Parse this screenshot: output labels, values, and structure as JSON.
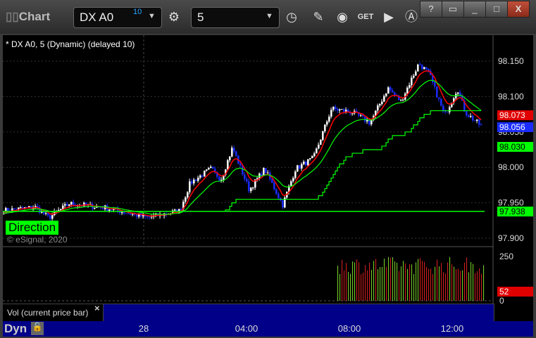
{
  "window": {
    "title": "Chart",
    "help": "?",
    "min": "_",
    "max": "□",
    "close": "X"
  },
  "toolbar": {
    "symbol": "DX A0",
    "symbol_badge": "10",
    "interval": "5"
  },
  "chart": {
    "legend": "* DX A0, 5 (Dynamic) (delayed 10)",
    "direction_label": "Direction",
    "copyright": "© eSignal, 2020",
    "price_ticks": [
      "98.150",
      "98.100",
      "98.050",
      "98.000",
      "97.950",
      "97.900"
    ],
    "price_labels": {
      "red_ma": "98.073",
      "last": "98.056",
      "green_ma": "98.030",
      "support": "97.938"
    },
    "vol_ticks": [
      "250",
      "0"
    ],
    "vol_label": "52",
    "vol_pane_title": "Vol (current price bar)",
    "vol_close": "×"
  },
  "datebar": {
    "mode": "Dyn",
    "ticks": [
      "28",
      "04:00",
      "08:00",
      "12:00"
    ]
  },
  "colors": {
    "up": "#ffffff",
    "down": "#1a2cff",
    "ma_fast": "#ff0000",
    "ma_slow": "#00ff00",
    "bg": "#000000",
    "pane": "#000088"
  },
  "chart_data": {
    "type": "candlestick",
    "ylim": [
      97.89,
      98.165
    ],
    "x_unit": "hours from 28 00:00",
    "xlim": [
      -5.5,
      13.6
    ],
    "path": [
      [
        -5.45,
        97.939
      ],
      [
        -4.2,
        97.944
      ],
      [
        -3.7,
        97.929
      ],
      [
        -2.9,
        97.949
      ],
      [
        -1.5,
        97.943
      ],
      [
        0.15,
        97.929
      ],
      [
        1.4,
        97.939
      ],
      [
        1.8,
        97.978
      ],
      [
        2.6,
        97.998
      ],
      [
        3.0,
        97.983
      ],
      [
        3.45,
        98.028
      ],
      [
        4.1,
        97.968
      ],
      [
        4.7,
        97.998
      ],
      [
        5.4,
        97.947
      ],
      [
        5.9,
        97.998
      ],
      [
        6.6,
        98.013
      ],
      [
        7.3,
        98.083
      ],
      [
        8.1,
        98.078
      ],
      [
        8.8,
        98.063
      ],
      [
        9.5,
        98.112
      ],
      [
        10.0,
        98.093
      ],
      [
        10.7,
        98.147
      ],
      [
        11.1,
        98.132
      ],
      [
        11.7,
        98.073
      ],
      [
        12.2,
        98.112
      ],
      [
        12.5,
        98.078
      ],
      [
        13.2,
        98.056
      ]
    ],
    "support_level": 97.938,
    "volume_ylim": [
      0,
      250
    ],
    "volume_start_hour": 7.55
  }
}
